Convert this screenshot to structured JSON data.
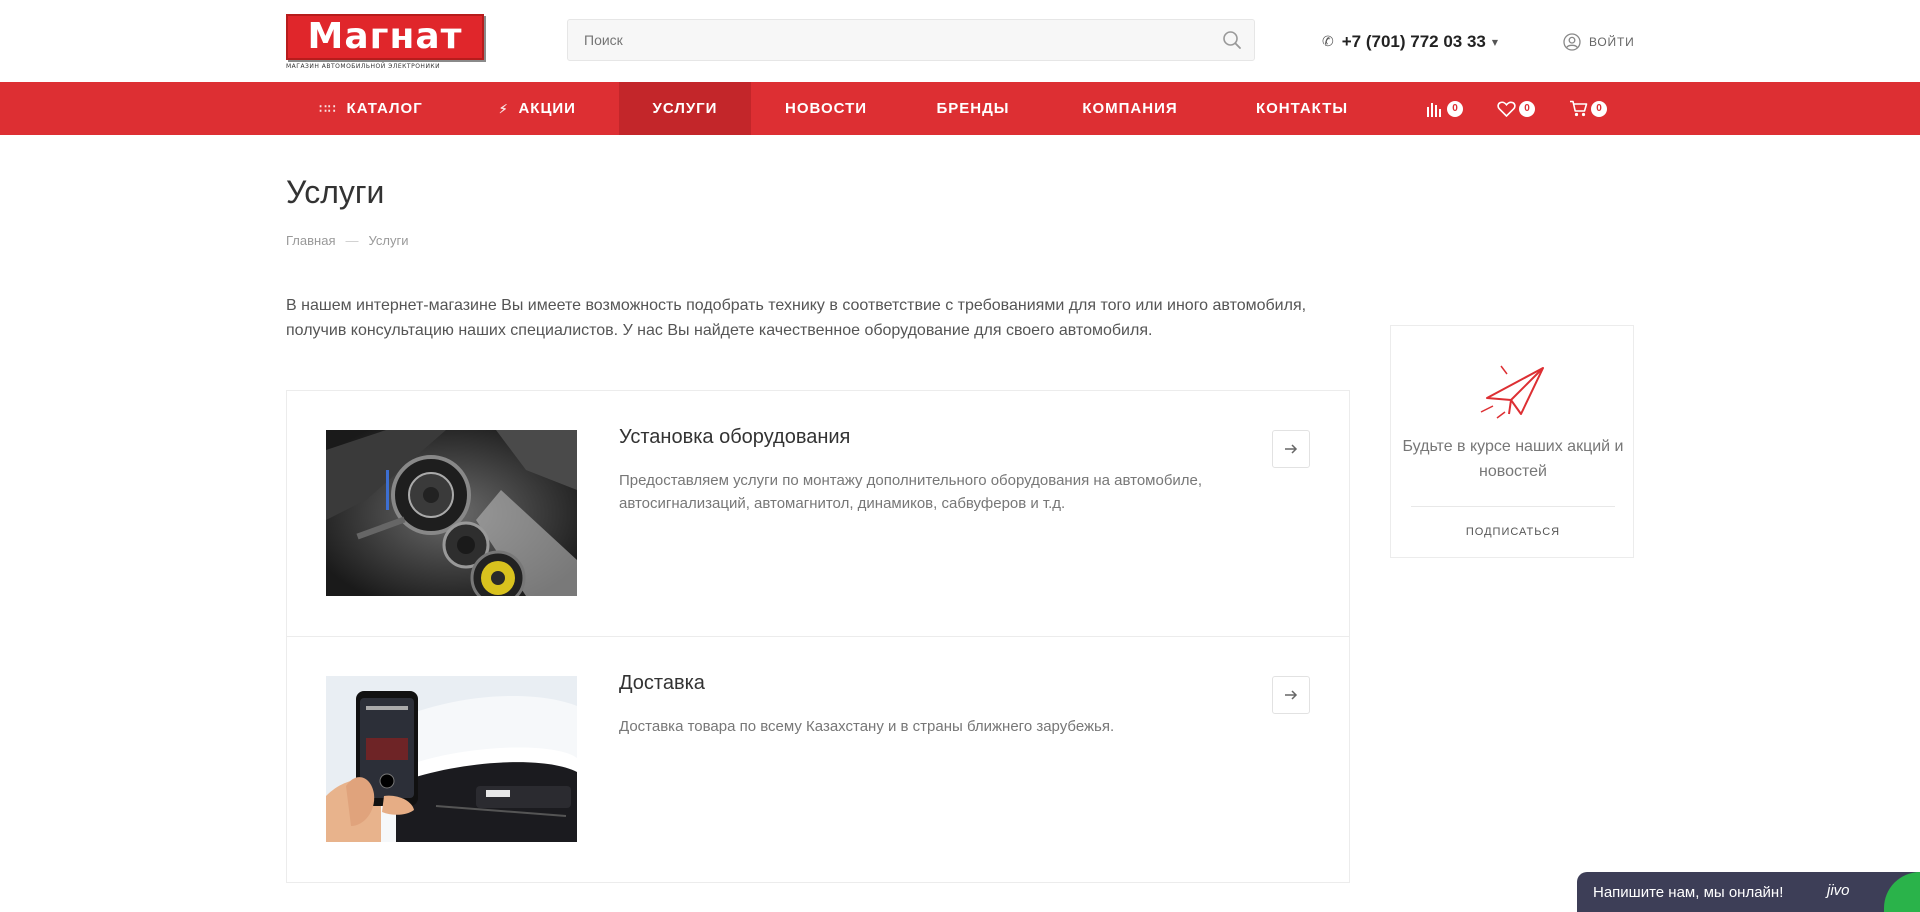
{
  "header": {
    "logo_text": "Магнат",
    "logo_subtitle": "МАГАЗИН АВТОМОБИЛЬНОЙ ЭЛЕКТРОНИКИ",
    "search_placeholder": "Поиск",
    "phone": "+7 (701) 772 03 33",
    "login_label": "ВОЙТИ"
  },
  "nav": {
    "items": [
      {
        "label": "КАТАЛОГ",
        "icon": "grid-icon"
      },
      {
        "label": "АКЦИИ",
        "icon": "lightning-icon"
      },
      {
        "label": "УСЛУГИ",
        "active": true
      },
      {
        "label": "НОВОСТИ"
      },
      {
        "label": "БРЕНДЫ"
      },
      {
        "label": "КОМПАНИЯ"
      },
      {
        "label": "КОНТАКТЫ"
      }
    ],
    "compare_count": "0",
    "favorites_count": "0",
    "cart_count": "0"
  },
  "page": {
    "title": "Услуги",
    "breadcrumb": {
      "home": "Главная",
      "separator": "—",
      "current": "Услуги"
    },
    "intro": "В нашем интернет-магазине Вы имеете возможность подобрать технику в соответствие с требованиями для того или иного автомобиля, получив консультацию наших специалистов. У нас Вы найдете качественное оборудование для своего автомобиля."
  },
  "services": [
    {
      "title": "Установка оборудования",
      "description": "Предоставляем услуги по монтажу дополнительного оборудования на автомобиле, автосигнализаций, автомагнитол, динамиков, сабвуферов и т.д."
    },
    {
      "title": "Доставка",
      "description": "Доставка товара по всему Казахстану и в страны ближнего зарубежья."
    }
  ],
  "subscribe": {
    "text": "Будьте в курсе наших акций и новостей",
    "button": "ПОДПИСАТЬСЯ"
  },
  "chat": {
    "label": "Напишите нам, мы онлайн!",
    "brand": "jivo"
  },
  "colors": {
    "brand_red": "#dd2f33",
    "nav_active": "#c3262a",
    "chat_bg": "#3d3e57",
    "online_green": "#2ab34a"
  }
}
